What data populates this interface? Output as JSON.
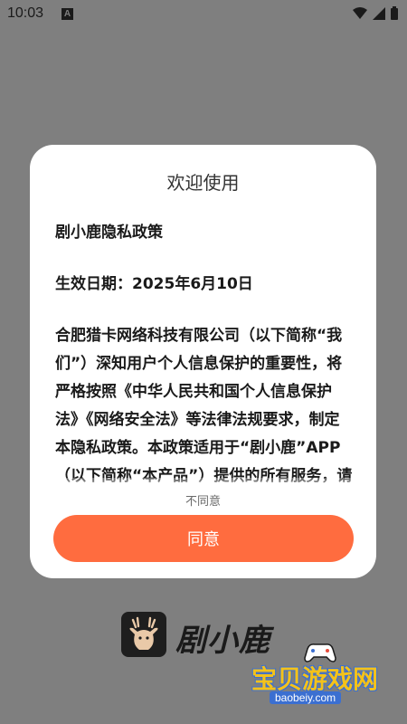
{
  "status_bar": {
    "time": "10:03",
    "notification_icon": "A"
  },
  "dialog": {
    "title": "欢迎使用",
    "policy_name": "剧小鹿隐私政策",
    "effective_date": "生效日期：2025年6月10日",
    "body": "合肥猎卡网络科技有限公司（以下简称“我们”）深知用户个人信息保护的重要性，将严格按照《中华人民共和国个人信息保护法》《网络安全法》等法律法规要求，制定本隐私政策。本政策适用于“剧小鹿”APP（以下简称“本产品”）提供的所有服务，请您",
    "disagree_label": "不同意",
    "agree_label": "同意"
  },
  "app": {
    "name": "剧小鹿"
  },
  "watermark": {
    "text": "宝贝游戏网",
    "url": "baobeiy.com"
  },
  "colors": {
    "overlay": "#7f7f7f",
    "accent": "#ff6c3f",
    "dialog_bg": "#ffffff"
  }
}
